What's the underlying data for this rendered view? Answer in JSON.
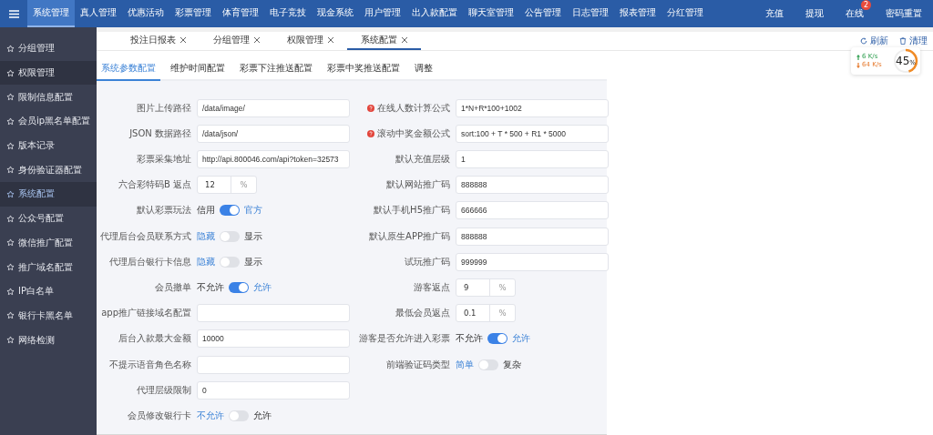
{
  "top_nav": {
    "items": [
      {
        "label": "系统管理",
        "selected": true
      },
      {
        "label": "真人管理",
        "selected": false
      },
      {
        "label": "优惠活动",
        "selected": false
      },
      {
        "label": "彩票管理",
        "selected": false
      },
      {
        "label": "体育管理",
        "selected": false
      },
      {
        "label": "电子竞技",
        "selected": false
      },
      {
        "label": "现金系统",
        "selected": false
      },
      {
        "label": "用户管理",
        "selected": false
      },
      {
        "label": "出入款配置",
        "selected": false
      },
      {
        "label": "聊天室管理",
        "selected": false
      },
      {
        "label": "公告管理",
        "selected": false
      },
      {
        "label": "日志管理",
        "selected": false
      },
      {
        "label": "报表管理",
        "selected": false
      },
      {
        "label": "分红管理",
        "selected": false
      }
    ],
    "actions": [
      {
        "label": "充值"
      },
      {
        "label": "提现"
      },
      {
        "label": "在线",
        "badge": "2"
      },
      {
        "label": "密码重置"
      }
    ]
  },
  "sidebar": {
    "items": [
      {
        "label": "分组管理",
        "selected": false,
        "hovered": false
      },
      {
        "label": "权限管理",
        "selected": false,
        "hovered": true
      },
      {
        "label": "限制信息配置",
        "selected": false,
        "hovered": false
      },
      {
        "label": "会员ip黑名单配置",
        "selected": false,
        "hovered": false
      },
      {
        "label": "版本记录",
        "selected": false,
        "hovered": false
      },
      {
        "label": "身份验证器配置",
        "selected": false,
        "hovered": false
      },
      {
        "label": "系统配置",
        "selected": true,
        "hovered": false
      },
      {
        "label": "公众号配置",
        "selected": false,
        "hovered": false
      },
      {
        "label": "微信推广配置",
        "selected": false,
        "hovered": false
      },
      {
        "label": "推广域名配置",
        "selected": false,
        "hovered": false
      },
      {
        "label": "IP白名单",
        "selected": false,
        "hovered": false
      },
      {
        "label": "银行卡黑名单",
        "selected": false,
        "hovered": false
      },
      {
        "label": "网络检测",
        "selected": false,
        "hovered": false
      }
    ]
  },
  "page_tabs": [
    {
      "label": "投注日报表",
      "selected": false
    },
    {
      "label": "分组管理",
      "selected": false
    },
    {
      "label": "权限管理",
      "selected": false
    },
    {
      "label": "系统配置",
      "selected": true
    }
  ],
  "tab_actions": [
    {
      "kind": "refresh",
      "label": "刷新"
    },
    {
      "kind": "clear",
      "label": "清理"
    }
  ],
  "network_widget": {
    "up": "6",
    "up_unit": "K/s",
    "down": "64",
    "down_unit": "K/s",
    "percent": "45",
    "percent_unit": "%",
    "level": 0.45
  },
  "sub_tabs": [
    {
      "label": "系统参数配置",
      "selected": true
    },
    {
      "label": "维护时间配置",
      "selected": false
    },
    {
      "label": "彩票下注推送配置",
      "selected": false
    },
    {
      "label": "彩票中奖推送配置",
      "selected": false
    },
    {
      "label": "调整",
      "selected": false
    }
  ],
  "form_left": [
    {
      "kind": "input",
      "label": "图片上传路径",
      "value": "/data/image/"
    },
    {
      "kind": "input",
      "label": "JSON 数据路径",
      "value": "/data/json/"
    },
    {
      "kind": "input",
      "label": "彩票采集地址",
      "value": "http://api.800046.com/api?token=32573"
    },
    {
      "kind": "percent",
      "label": "六合彩特码B 返点",
      "value": "12",
      "unit": "%"
    },
    {
      "kind": "switch",
      "label": "默认彩票玩法",
      "off_label": "信用",
      "on_label": "官方",
      "on": true
    },
    {
      "kind": "switch",
      "label": "代理后台会员联系方式",
      "off_label": "隐藏",
      "on_label": "显示",
      "on": false
    },
    {
      "kind": "switch",
      "label": "代理后台银行卡信息",
      "off_label": "隐藏",
      "on_label": "显示",
      "on": false
    },
    {
      "kind": "switch",
      "label": "会员撤单",
      "off_label": "不允许",
      "on_label": "允许",
      "on": true
    },
    {
      "kind": "input",
      "label": "app推广链接域名配置"
    },
    {
      "kind": "input",
      "label": "后台入款最大金额",
      "value": "10000"
    },
    {
      "kind": "input",
      "label": "不提示语音角色名称"
    },
    {
      "kind": "input",
      "label": "代理层级限制",
      "value": "0"
    },
    {
      "kind": "switch",
      "label": "会员修改银行卡",
      "off_label": "不允许",
      "on_label": "允许",
      "on": false
    }
  ],
  "form_right": [
    {
      "kind": "input",
      "label": "在线人数计算公式",
      "help": true,
      "value": "1*N+R*100+1002"
    },
    {
      "kind": "input",
      "label": "滚动中奖金额公式",
      "help": true,
      "value": "sort:100 + T * 500 + R1 * 5000"
    },
    {
      "kind": "input",
      "label": "默认充值层级",
      "value": "1"
    },
    {
      "kind": "input",
      "label": "默认网站推广码",
      "value": "888888"
    },
    {
      "kind": "input",
      "label": "默认手机H5推广码",
      "value": "666666"
    },
    {
      "kind": "input",
      "label": "默认原生APP推广码",
      "value": "888888"
    },
    {
      "kind": "input",
      "label": "试玩推广码",
      "value": "999999"
    },
    {
      "kind": "percent",
      "label": "游客返点",
      "value": "9",
      "unit": "%"
    },
    {
      "kind": "percent",
      "label": "最低会员返点",
      "value": "0.1",
      "unit": "%"
    },
    {
      "kind": "switch",
      "label": "游客是否允许进入彩票",
      "off_label": "不允许",
      "on_label": "允许",
      "on": true
    },
    {
      "kind": "switch",
      "label": "前端验证码类型",
      "off_label": "简单",
      "on_label": "复杂",
      "on": false
    }
  ]
}
